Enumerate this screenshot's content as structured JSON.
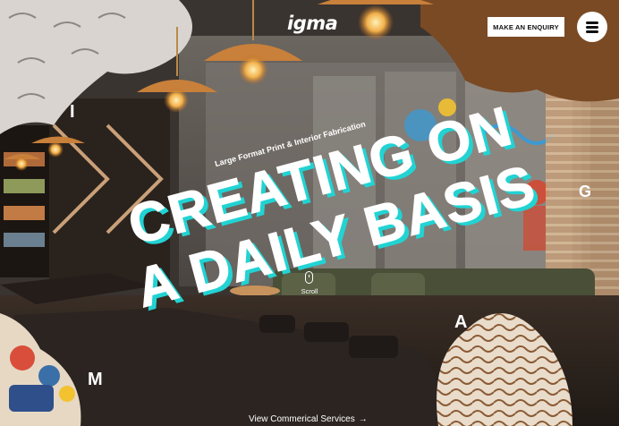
{
  "header": {
    "logo": "igma",
    "enquiry_label": "MAKE AN ENQUIRY",
    "menu_icon": "hamburger-menu-icon"
  },
  "hero": {
    "subtitle": "Large Format Print & Interior Fabrication",
    "headline_line1": "CREATING ON",
    "headline_line2": "A DAILY BASIS",
    "accent_color": "#22d3d3",
    "scroll_label": "Scroll",
    "scroll_icon": "mouse-scroll-icon"
  },
  "decor_letters": {
    "i": "I",
    "g": "G",
    "a": "A",
    "m": "M"
  },
  "footer_cta": {
    "label": "View Commerical Services",
    "icon": "arrow-right-icon"
  }
}
